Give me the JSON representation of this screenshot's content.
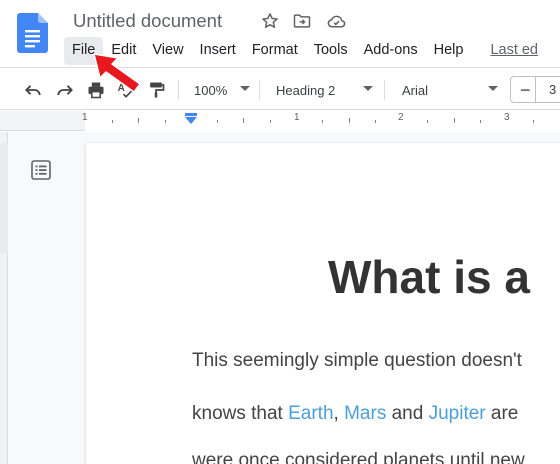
{
  "document": {
    "title": "Untitled document"
  },
  "menu": {
    "items": [
      {
        "label": "File"
      },
      {
        "label": "Edit"
      },
      {
        "label": "View"
      },
      {
        "label": "Insert"
      },
      {
        "label": "Format"
      },
      {
        "label": "Tools"
      },
      {
        "label": "Add-ons"
      },
      {
        "label": "Help"
      }
    ],
    "last_edit": "Last ed"
  },
  "toolbar": {
    "zoom": "100%",
    "style": "Heading 2",
    "font": "Arial",
    "font_size_minus": "−",
    "font_size": "3"
  },
  "ruler": {
    "numbers": [
      "1",
      "1",
      "2",
      "3"
    ]
  },
  "content": {
    "heading": "What is a",
    "line1": "This seemingly simple question doesn't",
    "line2_prefix": "knows that ",
    "line2_earth": "Earth",
    "line2_comma": ", ",
    "line2_mars": "Mars",
    "line2_and": " and ",
    "line2_jupiter": "Jupiter",
    "line2_suffix": " are",
    "line3": "were once considered planets until new"
  },
  "colors": {
    "docs_blue": "#4285f4",
    "link": "#4a9fd8",
    "arrow": "#e8191e"
  }
}
